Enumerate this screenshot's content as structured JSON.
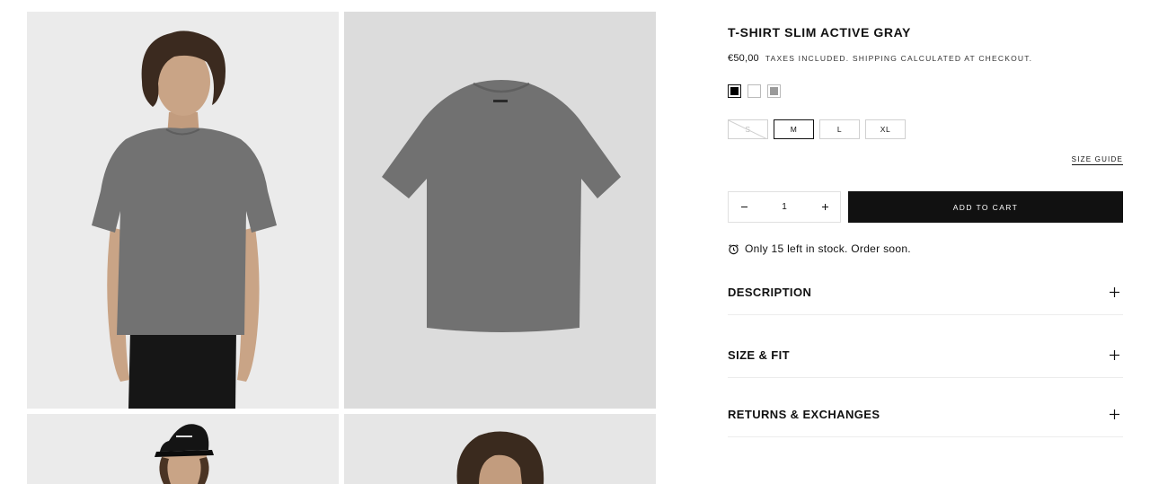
{
  "gallery": {
    "images": [
      {
        "alt": "Model wearing gray slim t-shirt, front view"
      },
      {
        "alt": "Gray t-shirt flat lay"
      },
      {
        "alt": "Model wearing black cap"
      },
      {
        "alt": "Model with curly hair"
      }
    ]
  },
  "product": {
    "title": "T-SHIRT SLIM ACTIVE GRAY",
    "price": "€50,00",
    "tax_note": "TAXES INCLUDED. SHIPPING CALCULATED AT CHECKOUT.",
    "colors": [
      {
        "name": "black",
        "hex": "#000000",
        "selected": true
      },
      {
        "name": "white",
        "hex": "#ffffff",
        "selected": false
      },
      {
        "name": "gray",
        "hex": "#9a9a9a",
        "selected": false
      }
    ],
    "sizes": [
      {
        "label": "S",
        "state": "unavailable"
      },
      {
        "label": "M",
        "state": "selected"
      },
      {
        "label": "L",
        "state": "available"
      },
      {
        "label": "XL",
        "state": "available"
      }
    ],
    "size_guide_label": "SIZE GUIDE",
    "quantity": "1",
    "add_to_cart_label": "ADD TO CART",
    "stock_message": "Only 15 left in stock. Order soon."
  },
  "accordions": [
    {
      "label": "DESCRIPTION"
    },
    {
      "label": "SIZE & FIT"
    },
    {
      "label": "RETURNS & EXCHANGES"
    }
  ],
  "icons": {
    "minus": "minus-icon",
    "plus": "plus-icon",
    "clock": "alarm-clock-icon"
  },
  "colors": {
    "shirt": "#6f6f6f",
    "button_bg": "#111111"
  }
}
